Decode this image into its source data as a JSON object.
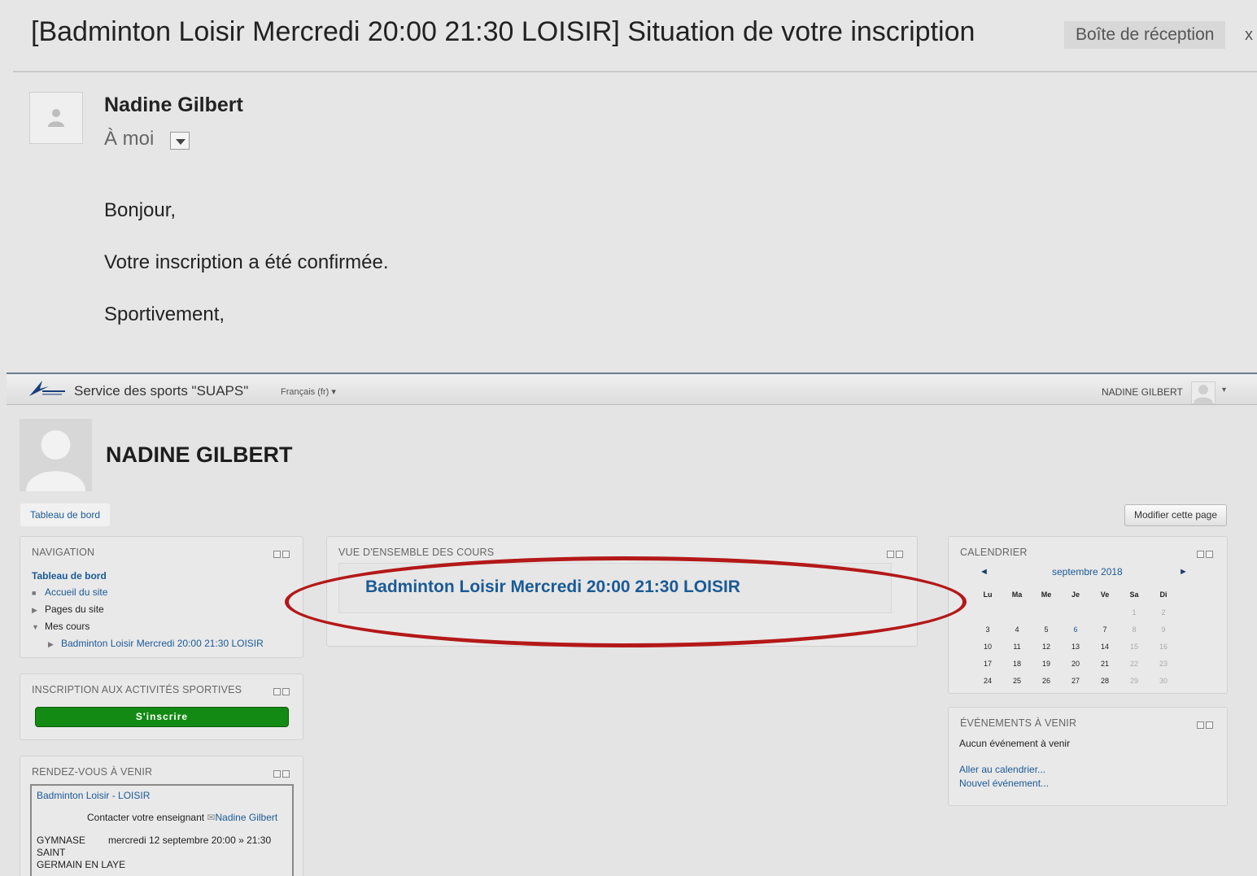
{
  "email": {
    "subject": "[Badminton Loisir Mercredi 20:00 21:30 LOISIR] Situation de votre inscription",
    "label": "Boîte de réception",
    "label_close": "x",
    "sender_name": "Nadine Gilbert",
    "recipient": "À moi",
    "body": [
      "Bonjour,",
      "Votre inscription a été confirmée.",
      "Sportivement,"
    ]
  },
  "navbar": {
    "site_name": "Service des sports \"SUAPS\"",
    "language": "Français (fr) ▾",
    "user_name": "NADINE GILBERT",
    "user_caret": "▾"
  },
  "profile": {
    "name": "NADINE GILBERT"
  },
  "breadcrumb": "Tableau de bord",
  "edit_button": "Modifier cette page",
  "navigation": {
    "title": "NAVIGATION",
    "items": [
      "Tableau de bord",
      "Accueil du site",
      "Pages du site",
      "Mes cours",
      "Badminton Loisir Mercredi 20:00 21:30 LOISIR"
    ]
  },
  "inscription": {
    "title": "INSCRIPTION AUX ACTIVITÉS SPORTIVES",
    "button": "S'inscrire"
  },
  "rendezvous": {
    "title": "RENDEZ-VOUS À VENIR",
    "course": "Badminton Loisir - LOISIR",
    "contact_label": "Contacter votre enseignant",
    "contact_name": "Nadine Gilbert",
    "place_line1": "GYMNASE",
    "place_line2": "SAINT",
    "place_line3": "GERMAIN EN LAYE",
    "datetime": "mercredi 12 septembre 20:00 » 21:30"
  },
  "overview": {
    "title": "VUE D'ENSEMBLE DES COURS",
    "course": "Badminton Loisir Mercredi 20:00 21:30 LOISIR"
  },
  "calendar": {
    "title": "CALENDRIER",
    "month": "septembre 2018",
    "prev": "◄",
    "next": "►",
    "days": [
      "Lu",
      "Ma",
      "Me",
      "Je",
      "Ve",
      "Sa",
      "Di"
    ],
    "weeks": [
      [
        "",
        "",
        "",
        "",
        "",
        "1",
        "2"
      ],
      [
        "3",
        "4",
        "5",
        "6",
        "7",
        "8",
        "9"
      ],
      [
        "10",
        "11",
        "12",
        "13",
        "14",
        "15",
        "16"
      ],
      [
        "17",
        "18",
        "19",
        "20",
        "21",
        "22",
        "23"
      ],
      [
        "24",
        "25",
        "26",
        "27",
        "28",
        "29",
        "30"
      ]
    ],
    "event_day": "6"
  },
  "events": {
    "title": "ÉVÉNEMENTS À VENIR",
    "none": "Aucun événement à venir",
    "goto_calendar": "Aller au calendrier...",
    "new_event": "Nouvel événement..."
  },
  "colors": {
    "link": "#1a5a96",
    "subscribe_button": "#138a13",
    "highlight_oval": "#b41818"
  }
}
